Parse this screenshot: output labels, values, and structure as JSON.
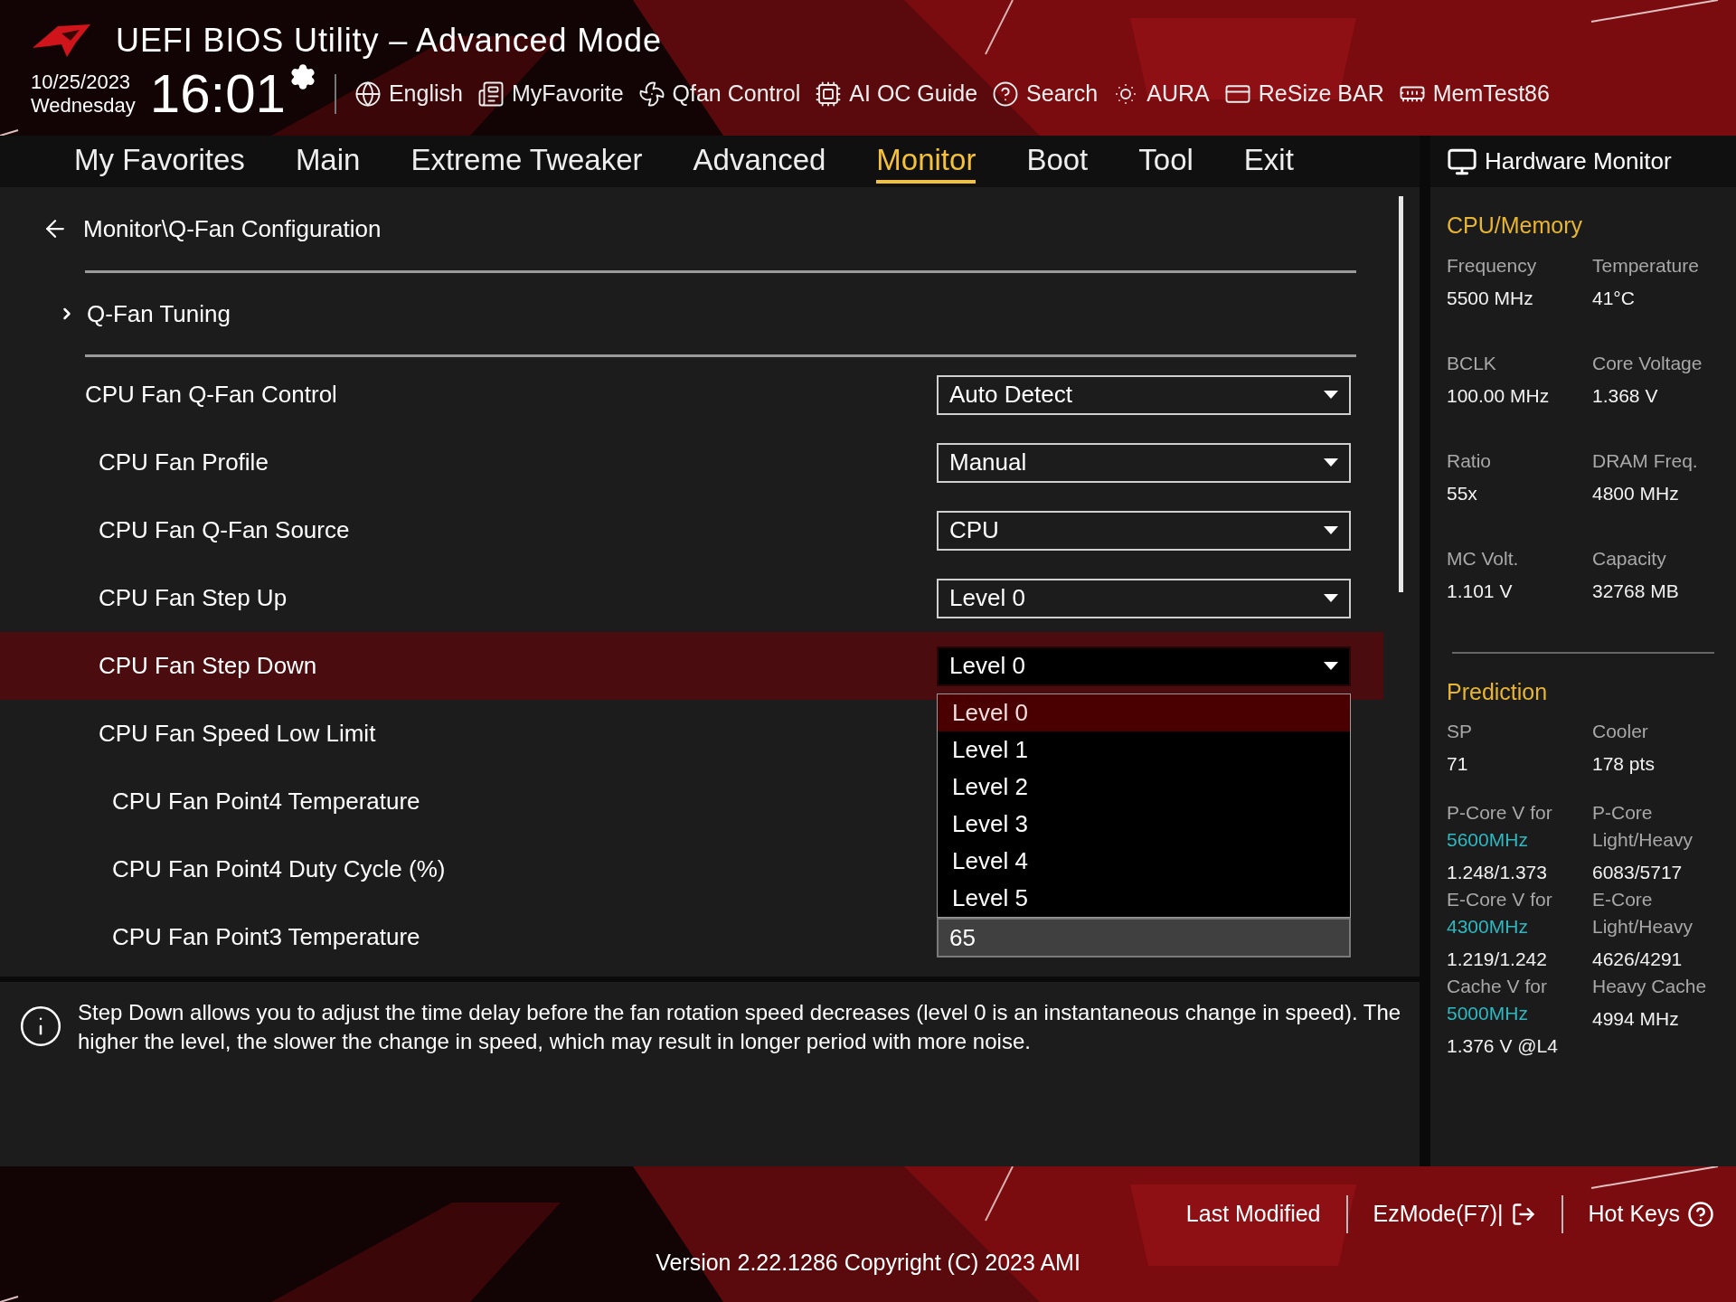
{
  "header": {
    "title": "UEFI BIOS Utility – Advanced Mode",
    "date": "10/25/2023",
    "weekday": "Wednesday",
    "time": "16:01"
  },
  "toolbar": [
    {
      "kind": "globe",
      "label": "English"
    },
    {
      "kind": "favorite",
      "label": "MyFavorite"
    },
    {
      "kind": "fan",
      "label": "Qfan Control"
    },
    {
      "kind": "chip",
      "label": "AI OC Guide"
    },
    {
      "kind": "search",
      "label": "Search"
    },
    {
      "kind": "aura",
      "label": "AURA"
    },
    {
      "kind": "card",
      "label": "ReSize BAR"
    },
    {
      "kind": "memory",
      "label": "MemTest86"
    }
  ],
  "tabs": [
    {
      "label": "My Favorites",
      "selected": false
    },
    {
      "label": "Main",
      "selected": false
    },
    {
      "label": "Extreme Tweaker",
      "selected": false
    },
    {
      "label": "Advanced",
      "selected": false
    },
    {
      "label": "Monitor",
      "selected": true
    },
    {
      "label": "Boot",
      "selected": false
    },
    {
      "label": "Tool",
      "selected": false
    },
    {
      "label": "Exit",
      "selected": false
    }
  ],
  "breadcrumb": "Monitor\\Q-Fan Configuration",
  "submenu": {
    "label": "Q-Fan Tuning"
  },
  "settings": [
    {
      "label": "CPU Fan Q-Fan Control",
      "kind": "select",
      "value": "Auto Detect",
      "selected": false,
      "children": [
        {
          "label": "CPU Fan Profile",
          "kind": "select",
          "value": "Manual",
          "selected": false
        },
        {
          "label": "CPU Fan Q-Fan Source",
          "kind": "select",
          "value": "CPU",
          "selected": false
        },
        {
          "label": "CPU Fan Step Up",
          "kind": "select",
          "value": "Level 0",
          "selected": false
        },
        {
          "label": "CPU Fan Step Down",
          "kind": "select",
          "value": "Level 0",
          "selected": true,
          "options": [
            {
              "label": "Level 0",
              "selected": true
            },
            {
              "label": "Level 1",
              "selected": false
            },
            {
              "label": "Level 2",
              "selected": false
            },
            {
              "label": "Level 3",
              "selected": false
            },
            {
              "label": "Level 4",
              "selected": false
            },
            {
              "label": "Level 5",
              "selected": false
            }
          ]
        },
        {
          "label": "CPU Fan Speed Low Limit",
          "kind": "hidden",
          "selected": false,
          "children": [
            {
              "label": "CPU Fan Point4 Temperature",
              "kind": "hidden",
              "selected": false
            },
            {
              "label": "CPU Fan Point4 Duty Cycle (%)",
              "kind": "hidden",
              "selected": false
            },
            {
              "label": "CPU Fan Point3 Temperature",
              "kind": "input",
              "value": "65",
              "selected": false
            }
          ]
        }
      ]
    }
  ],
  "help": "Step Down allows you to adjust the time delay before the fan rotation speed decreases (level 0 is an instantaneous change in speed). The higher the level, the slower the change in speed, which may result in longer period with more noise.",
  "hardware_monitor": {
    "title": "Hardware Monitor",
    "sections": [
      {
        "title": "CPU/Memory",
        "items": [
          {
            "label": "Frequency",
            "value": "5500 MHz"
          },
          {
            "label": "Temperature",
            "value": "41°C"
          },
          {
            "label": "BCLK",
            "value": "100.00 MHz"
          },
          {
            "label": "Core Voltage",
            "value": "1.368 V"
          },
          {
            "label": "Ratio",
            "value": "55x"
          },
          {
            "label": "DRAM Freq.",
            "value": "4800 MHz"
          },
          {
            "label": "MC Volt.",
            "value": "1.101 V"
          },
          {
            "label": "Capacity",
            "value": "32768 MB"
          }
        ]
      },
      {
        "title": "Prediction",
        "items": [
          {
            "label": "SP",
            "value": "71"
          },
          {
            "label": "Cooler",
            "value": "178 pts"
          },
          {
            "label": "P-Core V for",
            "highlight": "5600MHz",
            "value": "1.248/1.373"
          },
          {
            "label": "P-Core Light/Heavy",
            "value": "6083/5717"
          },
          {
            "label": "E-Core V for",
            "highlight": "4300MHz",
            "value": "1.219/1.242"
          },
          {
            "label": "E-Core Light/Heavy",
            "value": "4626/4291"
          },
          {
            "label": "Cache V for",
            "highlight": "5000MHz",
            "value": "1.376 V @L4"
          },
          {
            "label": "Heavy Cache",
            "value": "4994 MHz"
          }
        ]
      }
    ]
  },
  "footer": {
    "buttons": [
      {
        "kind": "last",
        "label": "Last Modified"
      },
      {
        "kind": "ezmode",
        "label": "EzMode(F7)|"
      },
      {
        "kind": "hotkeys",
        "label": "Hot Keys"
      }
    ],
    "version": "Version 2.22.1286 Copyright (C) 2023 AMI"
  }
}
